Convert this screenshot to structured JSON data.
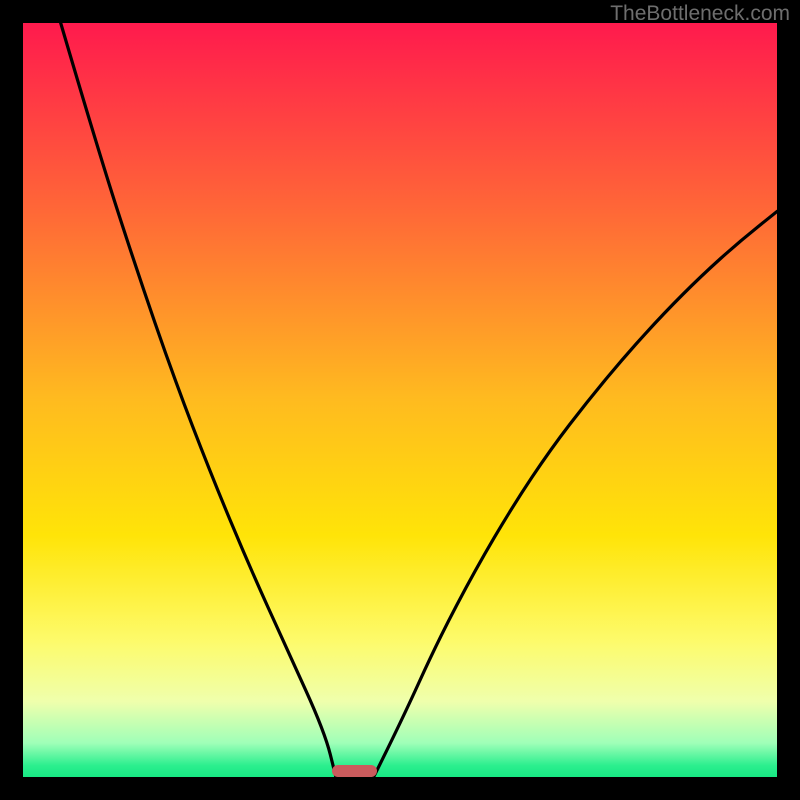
{
  "watermark": "TheBottleneck.com",
  "chart_data": {
    "type": "line",
    "title": "",
    "xlabel": "",
    "ylabel": "",
    "xlim": [
      0,
      100
    ],
    "ylim": [
      0,
      100
    ],
    "grid": false,
    "legend": false,
    "gradient_stops": [
      {
        "offset": 0.0,
        "color": "#ff1a4d"
      },
      {
        "offset": 0.25,
        "color": "#ff6837"
      },
      {
        "offset": 0.5,
        "color": "#ffbb1f"
      },
      {
        "offset": 0.68,
        "color": "#ffe408"
      },
      {
        "offset": 0.82,
        "color": "#fdfb6b"
      },
      {
        "offset": 0.9,
        "color": "#efffac"
      },
      {
        "offset": 0.955,
        "color": "#9fffb8"
      },
      {
        "offset": 0.985,
        "color": "#2bef8e"
      },
      {
        "offset": 1.0,
        "color": "#18e884"
      }
    ],
    "series": [
      {
        "name": "left-curve",
        "x": [
          5,
          10,
          15,
          20,
          25,
          30,
          35,
          40,
          41.5
        ],
        "y": [
          100,
          83,
          67.5,
          53,
          40,
          28,
          17,
          6,
          0
        ]
      },
      {
        "name": "right-curve",
        "x": [
          46.5,
          50,
          55,
          60,
          65,
          70,
          75,
          80,
          85,
          90,
          95,
          100
        ],
        "y": [
          0,
          7,
          18,
          27.5,
          36,
          43.5,
          50,
          56,
          61.5,
          66.5,
          71,
          75
        ]
      }
    ],
    "marker": {
      "name": "bottleneck-marker",
      "x_center": 44,
      "width_pct": 6.0,
      "height_pct": 1.6,
      "color": "#ca5b5d"
    }
  }
}
